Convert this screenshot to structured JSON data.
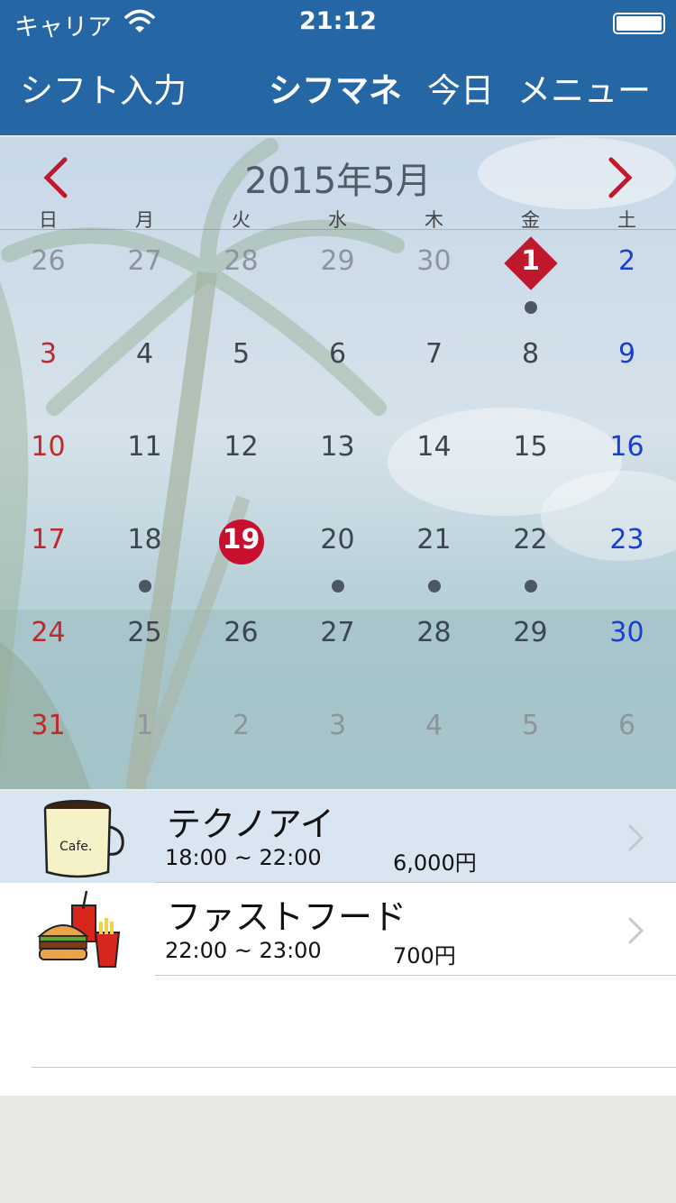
{
  "status_bar": {
    "carrier": "キャリア",
    "time": "21:12",
    "icons": [
      "wifi-icon",
      "battery-icon"
    ]
  },
  "navbar": {
    "shift_input": "シフト入力",
    "title": "シフマネ",
    "today": "今日",
    "menu": "メニュー"
  },
  "calendar": {
    "month_title": "2015年5月",
    "weekdays": [
      "日",
      "月",
      "火",
      "水",
      "木",
      "金",
      "土"
    ],
    "weeks": [
      [
        "26",
        "27",
        "28",
        "29",
        "30",
        "1",
        "2"
      ],
      [
        "3",
        "4",
        "5",
        "6",
        "7",
        "8",
        "9"
      ],
      [
        "10",
        "11",
        "12",
        "13",
        "14",
        "15",
        "16"
      ],
      [
        "17",
        "18",
        "19",
        "20",
        "21",
        "22",
        "23"
      ],
      [
        "24",
        "25",
        "26",
        "27",
        "28",
        "29",
        "30"
      ],
      [
        "31",
        "1",
        "2",
        "3",
        "4",
        "5",
        "6"
      ]
    ],
    "selected_day": "1",
    "today": "19",
    "days_with_shifts": [
      "1",
      "18",
      "20",
      "21",
      "22"
    ]
  },
  "shifts": [
    {
      "name": "テクノアイ",
      "hours": "18:00 ~  22:00",
      "pay": "6,000円",
      "icon": "coffee-cafe-icon",
      "icon_text": "Cafe."
    },
    {
      "name": "ファストフード",
      "hours": "22:00 ~  23:00",
      "pay": "700円",
      "icon": "fast-food-icon"
    }
  ],
  "colors": {
    "navbar": "#2566a4",
    "sunday": "#c0282d",
    "saturday": "#1a3fd0",
    "marker": "#c8102e",
    "selected_row": "#d9e6f1"
  }
}
